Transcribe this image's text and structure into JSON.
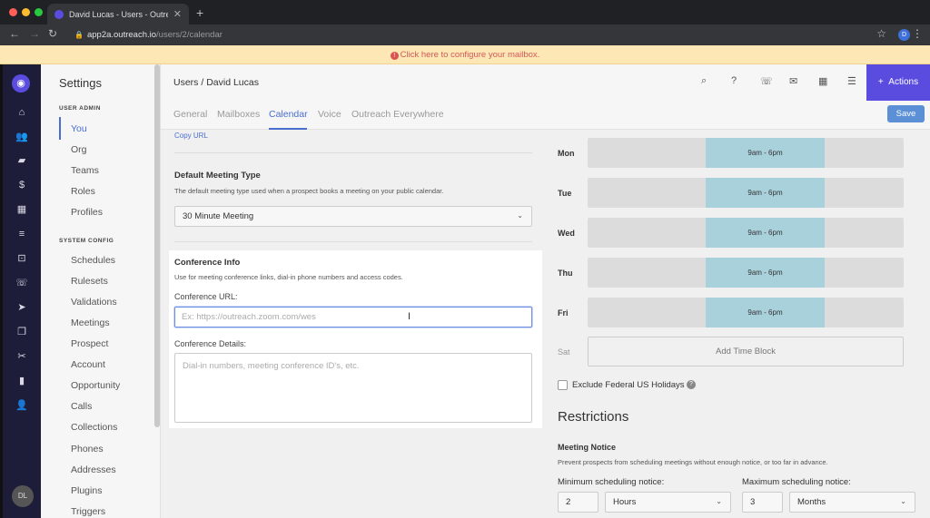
{
  "browser": {
    "tab_title": "David Lucas - Users - Outreach",
    "url_host": "app2a.outreach.io",
    "url_path": "/users/2/calendar",
    "profile_initial": "D"
  },
  "banner": {
    "text": "Click here to configure your mailbox."
  },
  "sidebar": {
    "avatar_initials": "DL"
  },
  "settings": {
    "title": "Settings",
    "user_admin_label": "USER ADMIN",
    "user_admin_items": [
      "You",
      "Org",
      "Teams",
      "Roles",
      "Profiles"
    ],
    "system_config_label": "SYSTEM CONFIG",
    "system_config_items": [
      "Schedules",
      "Rulesets",
      "Validations",
      "Meetings",
      "Prospect",
      "Account",
      "Opportunity",
      "Calls",
      "Collections",
      "Phones",
      "Addresses",
      "Plugins",
      "Triggers"
    ]
  },
  "header": {
    "breadcrumb_root": "Users",
    "breadcrumb_sep": "/",
    "breadcrumb_current": "David Lucas",
    "actions_label": "Actions"
  },
  "tabs": [
    "General",
    "Mailboxes",
    "Calendar",
    "Voice",
    "Outreach Everywhere"
  ],
  "save_label": "Save",
  "copy_url": "Copy URL",
  "meeting_type": {
    "title": "Default Meeting Type",
    "description": "The default meeting type used when a prospect books a meeting on your public calendar.",
    "value": "30 Minute Meeting"
  },
  "conference": {
    "title": "Conference Info",
    "description": "Use for meeting conference links, dial-in phone numbers and access codes.",
    "url_label": "Conference URL:",
    "url_placeholder": "Ex: https://outreach.zoom.com/wes",
    "details_label": "Conference Details:",
    "details_placeholder": "Dial-in numbers, meeting conference ID's, etc."
  },
  "availability": {
    "days": [
      {
        "day": "Mon",
        "block": "9am - 6pm"
      },
      {
        "day": "Tue",
        "block": "9am - 6pm"
      },
      {
        "day": "Wed",
        "block": "9am - 6pm"
      },
      {
        "day": "Thu",
        "block": "9am - 6pm"
      },
      {
        "day": "Fri",
        "block": "9am - 6pm"
      }
    ],
    "sat_label": "Sat",
    "add_block_label": "Add Time Block",
    "exclude_holidays_label": "Exclude Federal US Holidays"
  },
  "restrictions": {
    "title": "Restrictions",
    "meeting_notice_title": "Meeting Notice",
    "meeting_notice_desc": "Prevent prospects from scheduling meetings without enough notice, or too far in advance.",
    "min_label": "Minimum scheduling notice:",
    "min_value": "2",
    "min_unit": "Hours",
    "max_label": "Maximum scheduling notice:",
    "max_value": "3",
    "max_unit": "Months"
  }
}
